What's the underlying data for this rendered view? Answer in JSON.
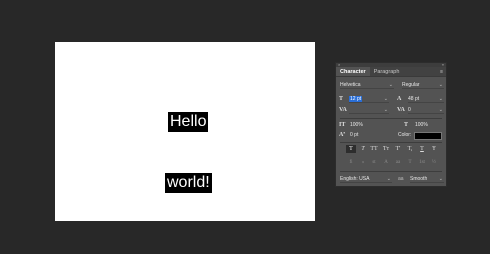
{
  "canvas": {
    "text_line_1": "Hello",
    "text_line_2": "world!"
  },
  "panel": {
    "tabs": [
      {
        "label": "Character",
        "active": true
      },
      {
        "label": "Paragraph",
        "active": false
      }
    ],
    "font_family": "Helvetica",
    "font_style": "Regular",
    "font_size": "12 pt",
    "leading": "48 pt",
    "kerning": "",
    "tracking": "0",
    "vertical_scale": "100%",
    "horizontal_scale": "100%",
    "baseline_shift": "0 pt",
    "color_label": "Color:",
    "color_value": "#000000",
    "style_buttons": [
      "T",
      "T",
      "TT",
      "Tт",
      "T'",
      "T,",
      "T",
      "Ŧ"
    ],
    "opentype_buttons": [
      "fi",
      "ℴ",
      "st",
      "A",
      "aa",
      "T",
      "1st",
      "½"
    ],
    "language": "English: USA",
    "aa_label": "aa",
    "antialias": "Smooth"
  },
  "icons": {
    "close": "×",
    "collapse": "»",
    "menu": "≡",
    "caret": "⌄"
  }
}
